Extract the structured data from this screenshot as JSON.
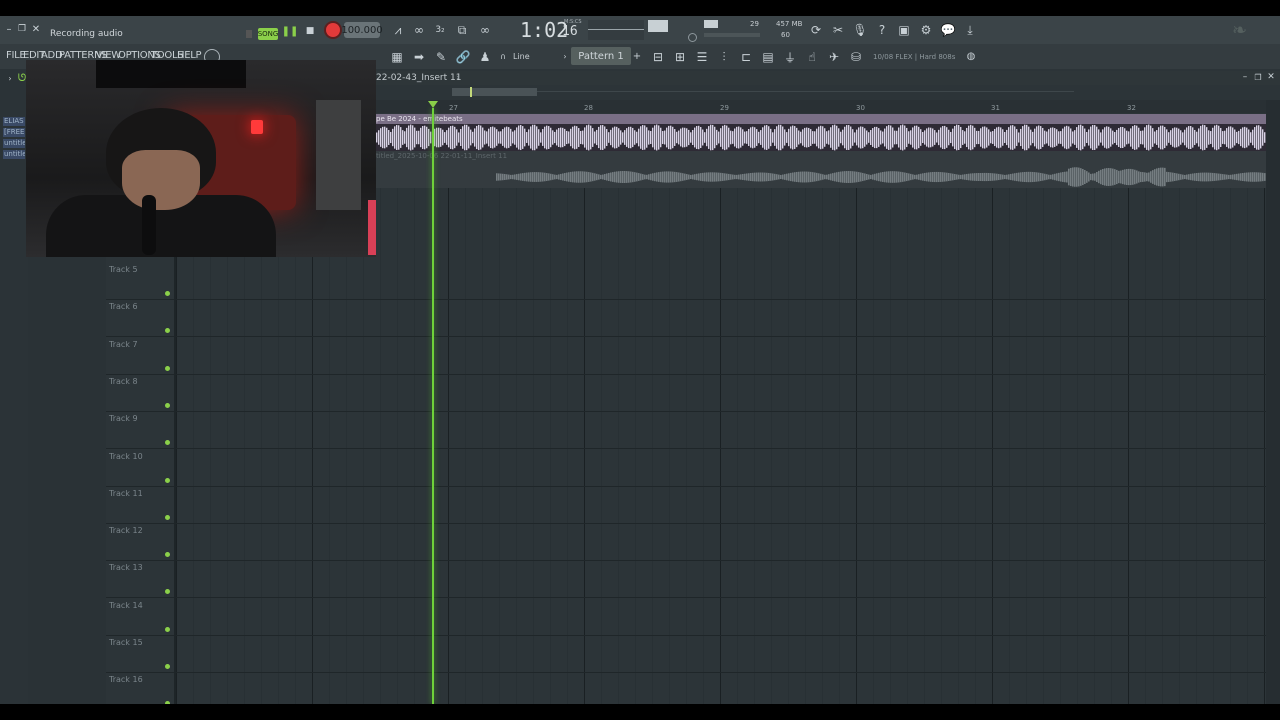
{
  "window": {
    "title": "Recording audio",
    "playlist_title": "22-02-43_Insert 11",
    "title_arrow": "›"
  },
  "transport": {
    "song_mode": "SONG",
    "tempo": "100.000",
    "time_main": "1:02",
    "time_sub": "16",
    "time_format": "M:S:CS",
    "cpu_voices": "29",
    "memory": "457 MB",
    "memory_sub": "60"
  },
  "menu": {
    "items": [
      "FILE",
      "EDIT",
      "ADD",
      "PATTERNS",
      "VIEW",
      "OPTIONS",
      "TOOLS",
      "HELP"
    ]
  },
  "toolbar": {
    "snap_label": "Line",
    "pattern_label": "Pattern 1",
    "pattern_add": "+",
    "hint_text": "10/08  FLEX | Hard 808s"
  },
  "ruler": {
    "bars": [
      "27",
      "28",
      "29",
      "30",
      "31",
      "32"
    ]
  },
  "clips": [
    {
      "name": "pe Be   2024 - emitebeats"
    },
    {
      "name": "titled_2025-10-06 22-01-11_Insert 11"
    }
  ],
  "browser_tags": [
    "ELIAS V",
    "[FREE]",
    "untitled",
    "untitled"
  ],
  "tracks": [
    {
      "label": "Track 5"
    },
    {
      "label": "Track 6"
    },
    {
      "label": "Track 7"
    },
    {
      "label": "Track 8"
    },
    {
      "label": "Track 9"
    },
    {
      "label": "Track 10"
    },
    {
      "label": "Track 11"
    },
    {
      "label": "Track 12"
    },
    {
      "label": "Track 13"
    },
    {
      "label": "Track 14"
    },
    {
      "label": "Track 15"
    },
    {
      "label": "Track 16"
    }
  ],
  "colors": {
    "accent_green": "#8bd04a",
    "record_red": "#e23a3a",
    "playhead": "#6fd13a",
    "clip_header": "#7a6f86",
    "waveform": "#d9d3e6"
  }
}
